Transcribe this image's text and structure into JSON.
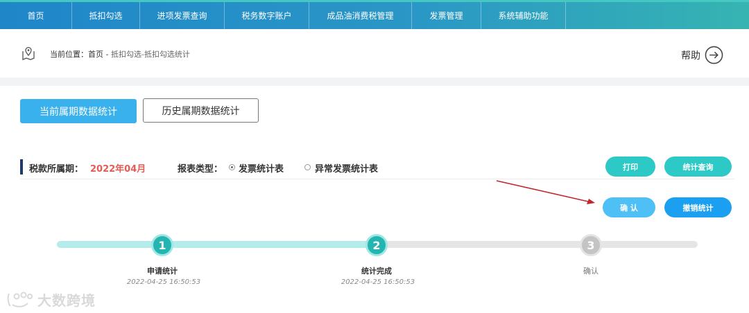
{
  "nav": {
    "items": [
      "首页",
      "抵扣勾选",
      "进项发票查询",
      "税务数字账户",
      "成品油消费税管理",
      "发票管理",
      "系统辅助功能"
    ]
  },
  "breadcrumb": {
    "prefix": "当前位置：首页 - ",
    "path": "抵扣勾选-抵扣勾选统计"
  },
  "help": {
    "label": "帮助",
    "icon": "arrow-right-circle-icon"
  },
  "tabs": {
    "current": "当前属期数据统计",
    "history": "历史属期数据统计"
  },
  "period": {
    "label": "税款所属期：",
    "value": "2022年04月"
  },
  "report_type": {
    "label": "报表类型：",
    "options": [
      {
        "label": "发票统计表",
        "selected": true
      },
      {
        "label": "异常发票统计表",
        "selected": false
      }
    ]
  },
  "buttons": {
    "print": "打印",
    "stats_query": "统计查询",
    "confirm": "确 认",
    "revoke": "撤销统计"
  },
  "steps": [
    {
      "number": "1",
      "label": "申请统计",
      "time": "2022-04-25 16:50:53",
      "status": "done"
    },
    {
      "number": "2",
      "label": "统计完成",
      "time": "2022-04-25 16:50:53",
      "status": "done"
    },
    {
      "number": "3",
      "label": "确认",
      "time": "",
      "status": "pending"
    }
  ],
  "progress": {
    "fraction": 0.5
  },
  "colors": {
    "accent": "#39b1ec",
    "teal": "#2cc9c6",
    "period_value": "#e45c55",
    "annotation_arrow": "#c0262b"
  },
  "watermark": {
    "text": "大数跨境"
  }
}
